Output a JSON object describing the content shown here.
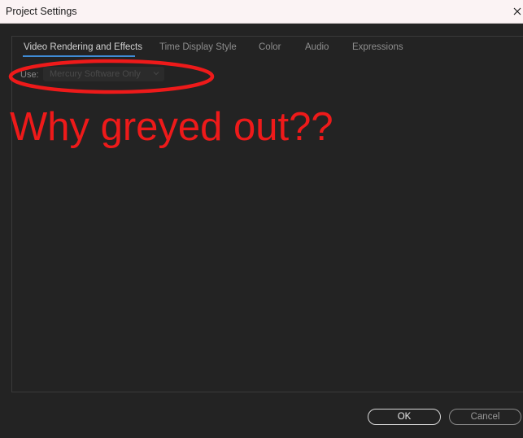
{
  "window": {
    "title": "Project Settings",
    "close_glyph": "×"
  },
  "tabs": [
    {
      "label": "Video Rendering and Effects",
      "active": true
    },
    {
      "label": "Time Display Style",
      "active": false
    },
    {
      "label": "Color",
      "active": false
    },
    {
      "label": "Audio",
      "active": false
    },
    {
      "label": "Expressions",
      "active": false
    }
  ],
  "renderer": {
    "label": "Use:",
    "value": "Mercury Software Only",
    "disabled": true
  },
  "annotation": {
    "text": "Why greyed out??",
    "color": "#ee1a1a"
  },
  "buttons": {
    "ok": "OK",
    "cancel": "Cancel"
  },
  "colors": {
    "background": "#232323",
    "accent": "#3f8cd6"
  }
}
